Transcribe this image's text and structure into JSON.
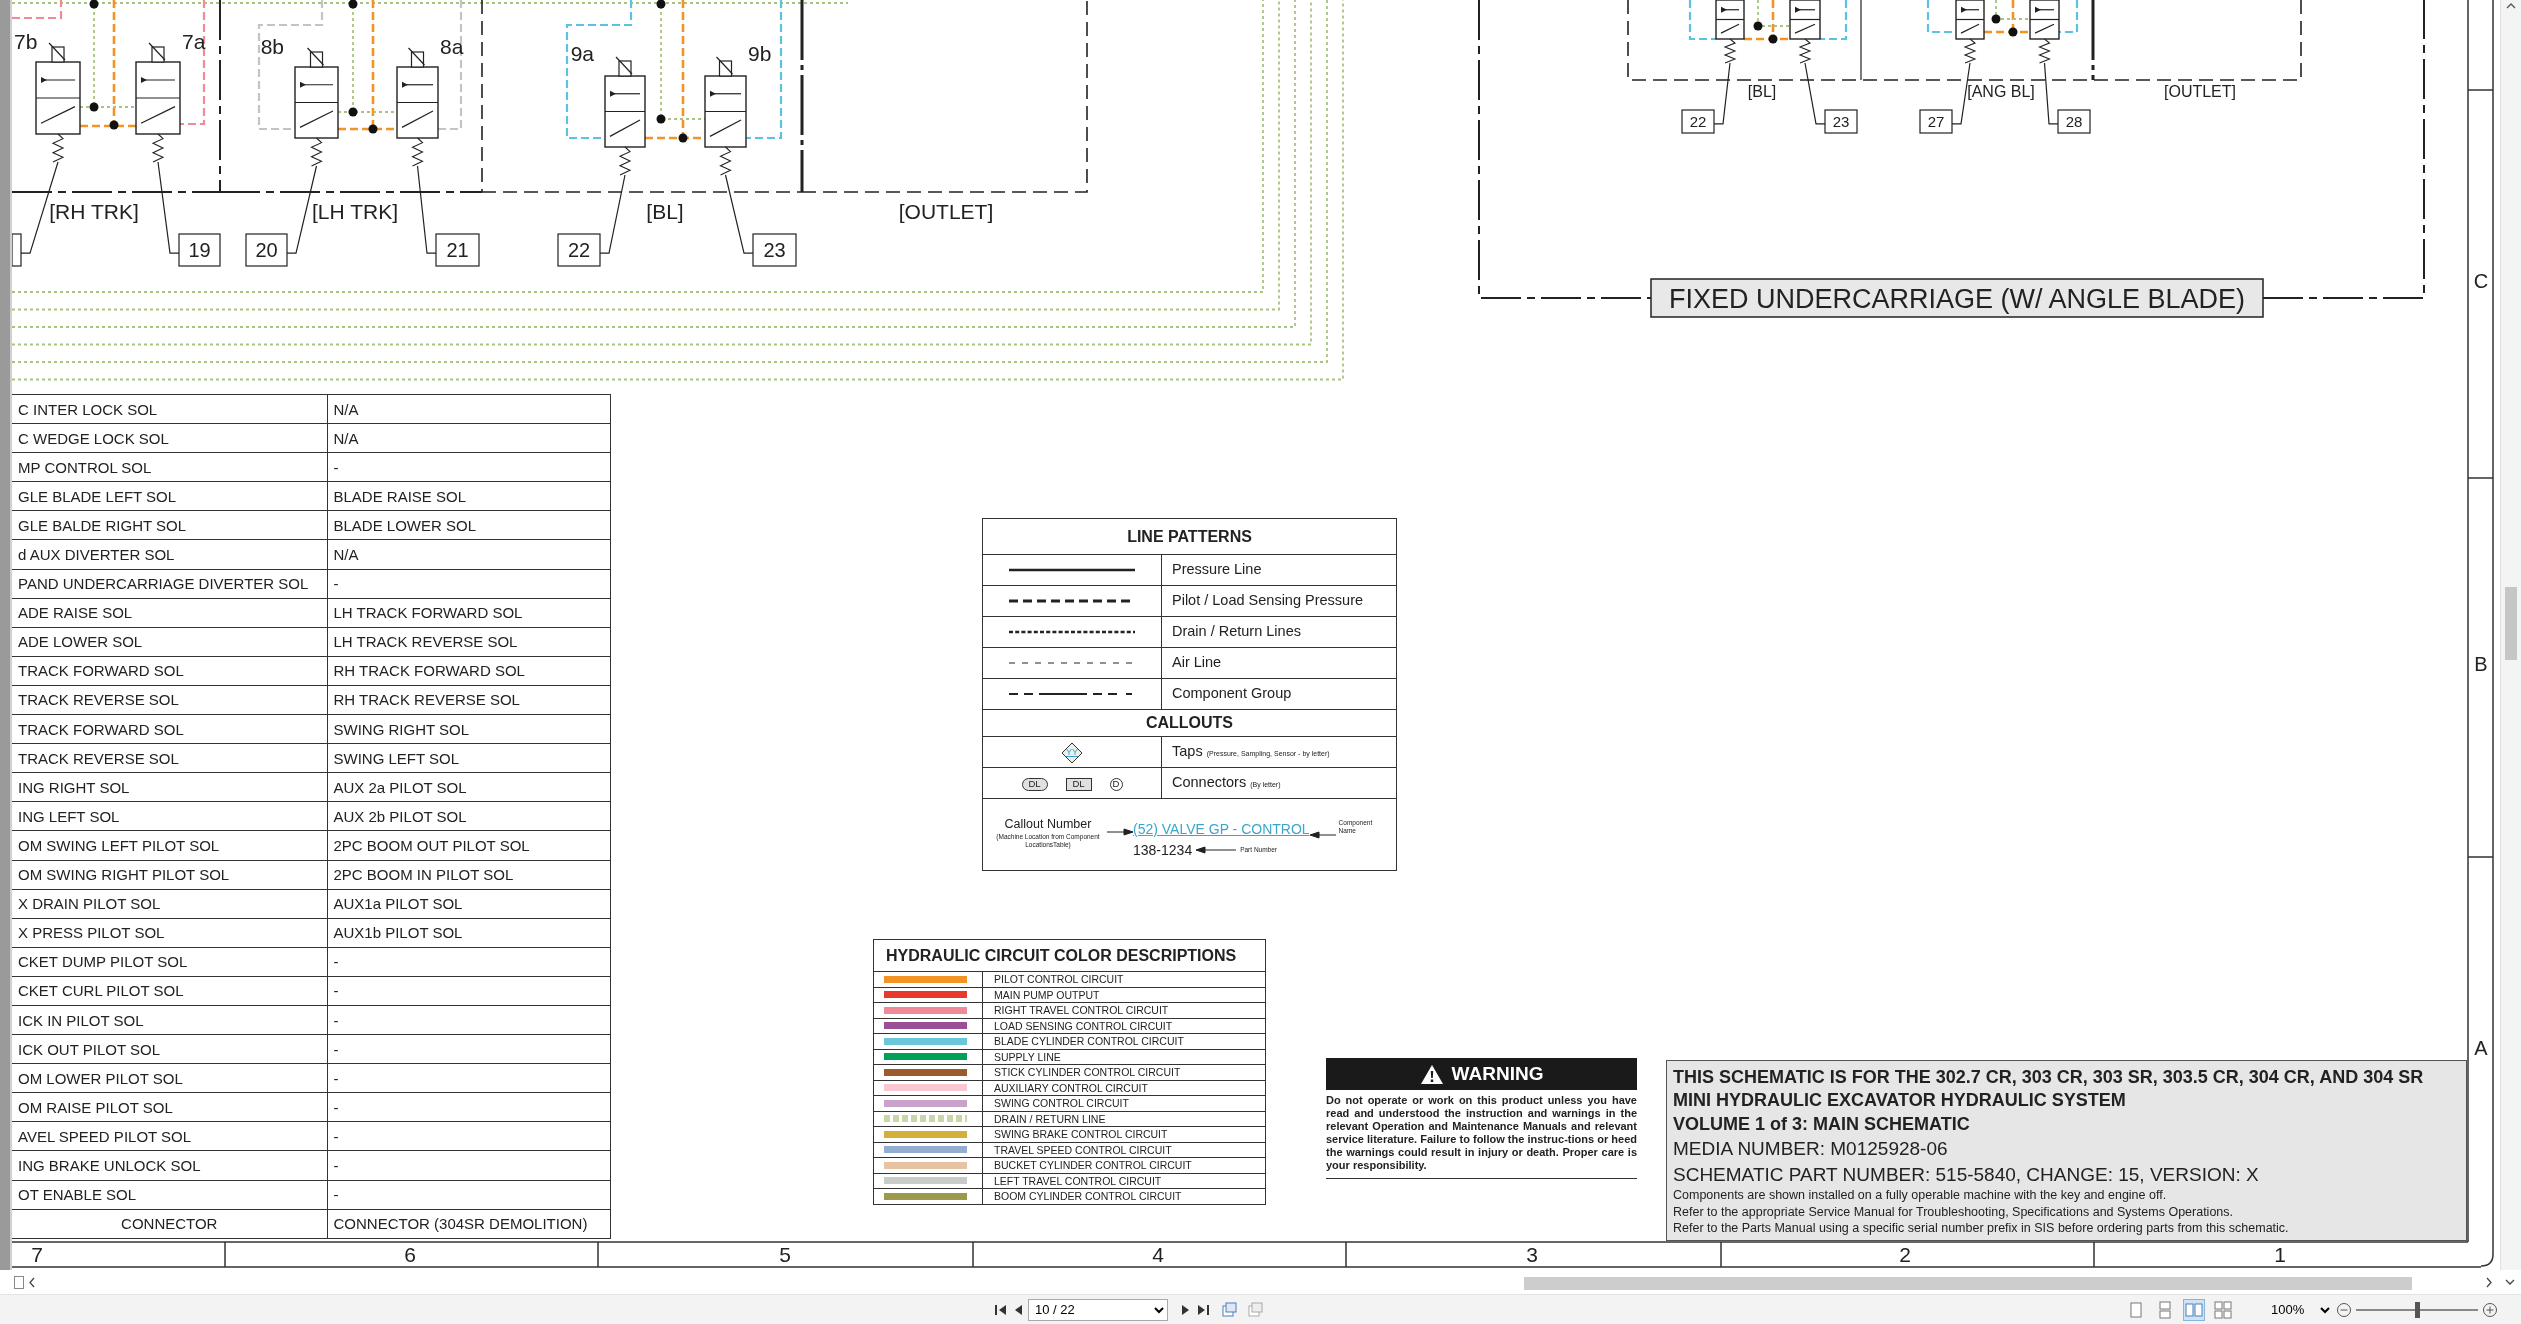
{
  "schematic": {
    "valves": [
      {
        "label": "7b"
      },
      {
        "label": "7a"
      },
      {
        "label": "8b"
      },
      {
        "label": "8a"
      },
      {
        "label": "9a"
      },
      {
        "label": "9b"
      }
    ],
    "groups": [
      {
        "label": "[RH TRK]"
      },
      {
        "label": "[LH TRK]"
      },
      {
        "label": "[BL]"
      },
      {
        "label": "[OUTLET]"
      }
    ],
    "callouts": [
      {
        "number": "19"
      },
      {
        "number": "20"
      },
      {
        "number": "21"
      },
      {
        "number": "22"
      },
      {
        "number": "23"
      }
    ],
    "undercarriage": {
      "title": "FIXED UNDERCARRIAGE (W/ ANGLE BLADE)",
      "groups": [
        {
          "label": "[BL]"
        },
        {
          "label": "[ANG BL]"
        },
        {
          "label": "[OUTLET]"
        }
      ],
      "callouts": [
        {
          "number": "22"
        },
        {
          "number": "23"
        },
        {
          "number": "27"
        },
        {
          "number": "28"
        }
      ]
    }
  },
  "solenoid_table": {
    "rows": [
      {
        "kind": "entry",
        "column_1": "C INTER LOCK SOL",
        "column_2": "N/A"
      },
      {
        "kind": "entry",
        "column_1": "C WEDGE LOCK SOL",
        "column_2": "N/A"
      },
      {
        "kind": "entry",
        "column_1": "MP CONTROL SOL",
        "column_2": "-"
      },
      {
        "kind": "entry",
        "column_1": "GLE BLADE LEFT SOL",
        "column_2": "BLADE RAISE SOL"
      },
      {
        "kind": "entry",
        "column_1": "GLE BALDE RIGHT SOL",
        "column_2": "BLADE LOWER SOL"
      },
      {
        "kind": "entry",
        "column_1": "d AUX DIVERTER SOL",
        "column_2": "N/A"
      },
      {
        "kind": "entry",
        "column_1": "PAND UNDERCARRIAGE DIVERTER SOL",
        "column_2": "-"
      },
      {
        "kind": "entry",
        "column_1": "ADE RAISE SOL",
        "column_2": "LH TRACK FORWARD SOL"
      },
      {
        "kind": "entry",
        "column_1": "ADE LOWER SOL",
        "column_2": "LH TRACK REVERSE SOL"
      },
      {
        "kind": "entry",
        "column_1": "TRACK FORWARD SOL",
        "column_2": "RH TRACK FORWARD SOL"
      },
      {
        "kind": "entry",
        "column_1": "TRACK REVERSE SOL",
        "column_2": "RH TRACK REVERSE SOL"
      },
      {
        "kind": "entry",
        "column_1": "TRACK FORWARD SOL",
        "column_2": "SWING RIGHT SOL"
      },
      {
        "kind": "entry",
        "column_1": "TRACK REVERSE SOL",
        "column_2": "SWING LEFT SOL"
      },
      {
        "kind": "entry",
        "column_1": "ING RIGHT SOL",
        "column_2": "AUX 2a PILOT SOL"
      },
      {
        "kind": "entry",
        "column_1": "ING LEFT SOL",
        "column_2": "AUX 2b PILOT SOL"
      },
      {
        "kind": "entry",
        "column_1": "OM SWING LEFT PILOT SOL",
        "column_2": "2PC BOOM OUT PILOT SOL"
      },
      {
        "kind": "entry",
        "column_1": "OM SWING RIGHT PILOT SOL",
        "column_2": "2PC BOOM IN PILOT SOL"
      },
      {
        "kind": "entry",
        "column_1": "X DRAIN PILOT SOL",
        "column_2": "AUX1a PILOT SOL"
      },
      {
        "kind": "entry",
        "column_1": "X PRESS PILOT SOL",
        "column_2": "AUX1b PILOT SOL"
      },
      {
        "kind": "entry",
        "column_1": "CKET DUMP PILOT SOL",
        "column_2": "-"
      },
      {
        "kind": "entry",
        "column_1": "CKET CURL PILOT SOL",
        "column_2": "-"
      },
      {
        "kind": "entry",
        "column_1": "ICK IN PILOT SOL",
        "column_2": "-"
      },
      {
        "kind": "entry",
        "column_1": "ICK OUT PILOT SOL",
        "column_2": "-"
      },
      {
        "kind": "entry",
        "column_1": "OM LOWER PILOT SOL",
        "column_2": "-"
      },
      {
        "kind": "entry",
        "column_1": "OM RAISE PILOT SOL",
        "column_2": "-"
      },
      {
        "kind": "entry",
        "column_1": "AVEL SPEED PILOT SOL",
        "column_2": "-"
      },
      {
        "kind": "entry",
        "column_1": "ING BRAKE UNLOCK SOL",
        "column_2": "-"
      },
      {
        "kind": "entry",
        "column_1": "OT ENABLE SOL",
        "column_2": "-"
      },
      {
        "kind": "footer",
        "column_1": "CONNECTOR",
        "column_2": "CONNECTOR (304SR DEMOLITION)"
      }
    ]
  },
  "line_patterns": {
    "title": "LINE PATTERNS",
    "rows": [
      {
        "kind": "solid",
        "label": "Pressure Line"
      },
      {
        "kind": "dashed",
        "label": "Pilot / Load Sensing Pressure"
      },
      {
        "kind": "dotted",
        "label": "Drain / Return Lines"
      },
      {
        "kind": "thin",
        "label": "Air Line"
      },
      {
        "kind": "group",
        "label": "Component Group"
      }
    ],
    "callouts_title": "CALLOUTS",
    "taps": {
      "symbol": "YY",
      "label": "Taps",
      "note": "(Pressure, Sampling, Sensor - by letter)"
    },
    "connectors": {
      "symbols": [
        {
          "kind": "pill",
          "text": "DL"
        },
        {
          "kind": "square",
          "text": "DL"
        },
        {
          "kind": "circle",
          "text": "D"
        }
      ],
      "label": "Connectors",
      "note": "(By letter)"
    },
    "callout_example": {
      "callout_number": "Callout Number",
      "callout_note": "(Machine Location from Component LocationsTable)",
      "component": "(52) VALVE GP - CONTROL",
      "part_number": "138-1234",
      "part_label": "Part Number",
      "component_label": "Component Name"
    }
  },
  "color_descriptions": {
    "title": "HYDRAULIC CIRCUIT COLOR DESCRIPTIONS",
    "rows": [
      {
        "kind": "solid",
        "color": "#f39325",
        "label": "PILOT CONTROL CIRCUIT"
      },
      {
        "kind": "solid",
        "color": "#e8392f",
        "label": "MAIN PUMP OUTPUT"
      },
      {
        "kind": "solid",
        "color": "#f08a99",
        "label": "RIGHT TRAVEL CONTROL CIRCUIT"
      },
      {
        "kind": "solid",
        "color": "#9b4f96",
        "label": "LOAD SENSING CONTROL CIRCUIT"
      },
      {
        "kind": "solid",
        "color": "#6cc6d9",
        "label": "BLADE CYLINDER CONTROL CIRCUIT"
      },
      {
        "kind": "solid",
        "color": "#00a05a",
        "label": "SUPPLY LINE"
      },
      {
        "kind": "solid",
        "color": "#9c5b2b",
        "label": "STICK CYLINDER CONTROL CIRCUIT"
      },
      {
        "kind": "solid",
        "color": "#f8c8d2",
        "label": "AUXILIARY CONTROL CIRCUIT"
      },
      {
        "kind": "solid",
        "color": "#c9a2cc",
        "label": "SWING CONTROL CIRCUIT"
      },
      {
        "kind": "dotted",
        "color": "#c8d6a8",
        "label": "DRAIN / RETURN LINE"
      },
      {
        "kind": "solid",
        "color": "#d4b03a",
        "label": "SWING BRAKE CONTROL CIRCUIT"
      },
      {
        "kind": "solid",
        "color": "#93aed0",
        "label": "TRAVEL SPEED CONTROL CIRCUIT"
      },
      {
        "kind": "solid",
        "color": "#e8c3a3",
        "label": "BUCKET CYLINDER CONTROL CIRCUIT"
      },
      {
        "kind": "solid",
        "color": "#c8ccc8",
        "label": "LEFT TRAVEL CONTROL CIRCUIT"
      },
      {
        "kind": "solid",
        "color": "#9a9a4a",
        "label": "BOOM CYLINDER CONTROL CIRCUIT"
      }
    ]
  },
  "warning": {
    "title": "WARNING",
    "text": "Do not operate or work on this product unless you have read and understood the instruction and warnings in the relevant Operation and Maintenance Manuals and relevant service literature. Failure to follow the instruc-tions or heed the warnings could result in injury or death. Proper care is your responsibility."
  },
  "title_block": {
    "lines": [
      {
        "kind": "heading",
        "text": "THIS SCHEMATIC IS FOR THE 302.7 CR, 303 CR, 303 SR, 303.5 CR, 304 CR, AND 304 SR"
      },
      {
        "kind": "heading",
        "text": "MINI HYDRAULIC EXCAVATOR HYDRAULIC SYSTEM"
      },
      {
        "kind": "heading",
        "text": "VOLUME 1 of 3: MAIN SCHEMATIC"
      },
      {
        "kind": "info",
        "text": "MEDIA NUMBER: M0125928-06"
      },
      {
        "kind": "info",
        "text": "SCHEMATIC PART NUMBER: 515-5840, CHANGE: 15, VERSION: X"
      },
      {
        "kind": "note",
        "text": "Components are shown installed on a fully operable machine with the key and engine off."
      },
      {
        "kind": "note",
        "text": "Refer to the appropriate Service Manual for Troubleshooting, Specifications and Systems Operations."
      },
      {
        "kind": "note",
        "text": "Refer to the Parts Manual using a specific serial number prefix in SIS before ordering parts from this schematic."
      }
    ]
  },
  "sheet": {
    "row_markers": [
      "C",
      "B",
      "A"
    ],
    "column_markers": [
      "7",
      "6",
      "5",
      "4",
      "3",
      "2",
      "1"
    ]
  },
  "viewer": {
    "page_field": "10 / 22",
    "zoom": "100%",
    "zoom_slider": {
      "level": 0.5
    },
    "view_modes": [
      {
        "selected": false
      },
      {
        "selected": false
      },
      {
        "selected": true
      },
      {
        "selected": false
      }
    ]
  }
}
